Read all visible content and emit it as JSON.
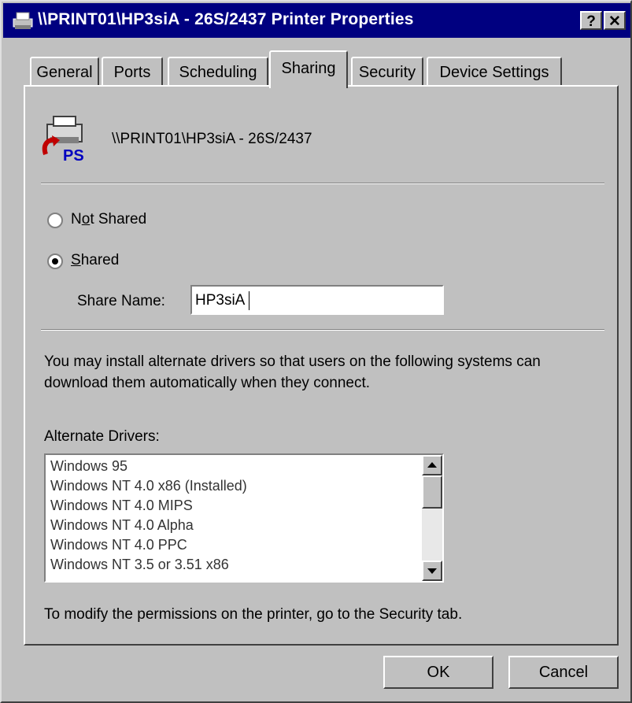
{
  "window": {
    "title": "\\\\PRINT01\\HP3siA - 26S/2437 Printer Properties"
  },
  "title_buttons": {
    "help": "?",
    "close": "✕"
  },
  "tabs": [
    {
      "label": "General"
    },
    {
      "label": "Ports"
    },
    {
      "label": "Scheduling"
    },
    {
      "label": "Sharing",
      "active": true
    },
    {
      "label": "Security"
    },
    {
      "label": "Device Settings"
    }
  ],
  "sharing": {
    "printer_name": "\\\\PRINT01\\HP3siA - 26S/2437",
    "not_shared_label": "Not Shared",
    "not_shared_access_key": "o",
    "shared_label": "Shared",
    "shared_access_key": "S",
    "selected": "Shared",
    "share_name_label": "Share Name:",
    "share_name_value": "HP3siA",
    "info_text": "You may install alternate drivers so that users on the following systems can download them automatically when they connect.",
    "alternate_drivers_label": "Alternate Drivers:",
    "alternate_drivers": [
      "Windows 95",
      "Windows NT 4.0 x86 (Installed)",
      "Windows NT 4.0 MIPS",
      "Windows NT 4.0 Alpha",
      "Windows NT 4.0 PPC",
      "Windows NT 3.5 or 3.51 x86"
    ],
    "permissions_text": "To modify the permissions on the printer, go to the Security tab."
  },
  "buttons": {
    "ok": "OK",
    "cancel": "Cancel"
  },
  "colors": {
    "titlebar": "#000080",
    "face": "#c0c0c0",
    "ps_label": "#0000c0"
  },
  "icons": {
    "title": "printer-icon",
    "printer": "shared-printer-icon"
  },
  "icon_text": {
    "ps": "PS"
  }
}
